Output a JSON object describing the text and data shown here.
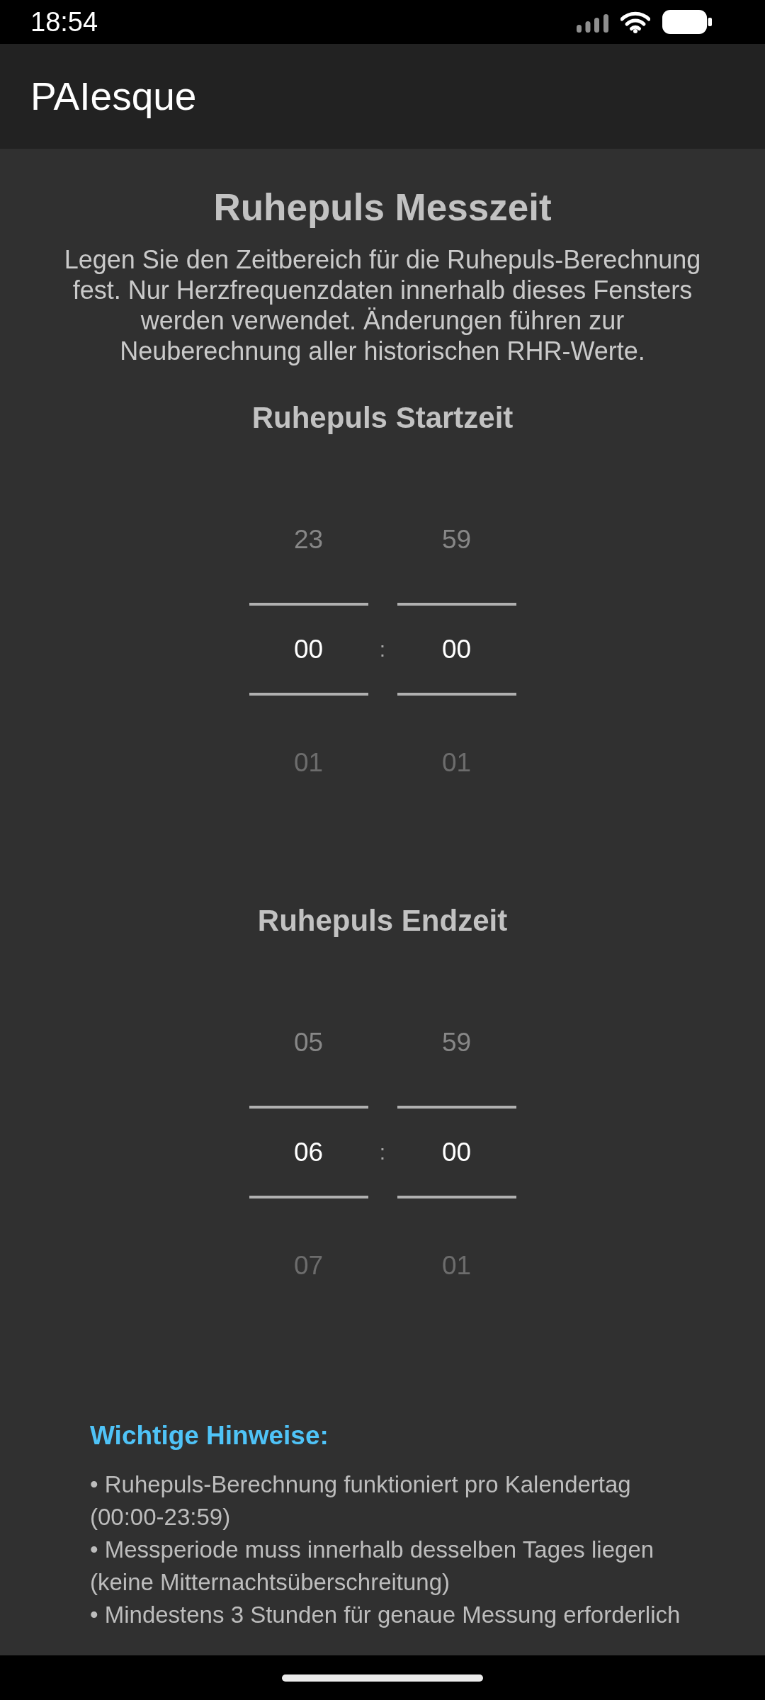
{
  "status_bar": {
    "time": "18:54"
  },
  "app_bar": {
    "title": "PAIesque"
  },
  "page": {
    "title": "Ruhepuls Messzeit",
    "description": "Legen Sie den Zeitbereich für die Ruhepuls-Berechnung fest. Nur Herzfrequenzdaten innerhalb dieses Fensters werden verwendet. Änderungen führen zur Neuberechnung aller historischen RHR-Werte."
  },
  "pickers": [
    {
      "heading": "Ruhepuls Startzeit",
      "separator": ":",
      "columns": [
        {
          "previous": "23",
          "value": "00",
          "next": "01"
        },
        {
          "previous": "59",
          "value": "00",
          "next": "01"
        }
      ]
    },
    {
      "heading": "Ruhepuls Endzeit",
      "separator": ":",
      "columns": [
        {
          "previous": "05",
          "value": "06",
          "next": "07"
        },
        {
          "previous": "59",
          "value": "00",
          "next": "01"
        }
      ]
    }
  ],
  "notes": {
    "heading": "Wichtige Hinweise:",
    "items": [
      "• Ruhepuls-Berechnung funktioniert pro Kalendertag (00:00-23:59)",
      "• Messperiode muss innerhalb desselben Tages liegen (keine Mitternachtsüberschreitung)",
      "• Mindestens 3 Stunden für genaue Messung erforderlich"
    ]
  }
}
